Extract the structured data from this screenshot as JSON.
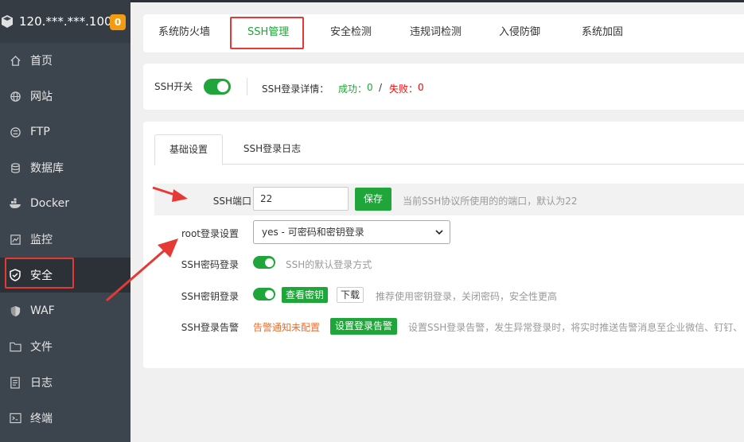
{
  "server": {
    "ip": "120.***.***.100",
    "badge_count": "0"
  },
  "sidebar": {
    "items": [
      {
        "label": "首页",
        "icon": "home-icon"
      },
      {
        "label": "网站",
        "icon": "globe-icon"
      },
      {
        "label": "FTP",
        "icon": "ftp-icon"
      },
      {
        "label": "数据库",
        "icon": "database-icon"
      },
      {
        "label": "Docker",
        "icon": "docker-icon"
      },
      {
        "label": "监控",
        "icon": "monitor-icon"
      },
      {
        "label": "安全",
        "icon": "shield-icon"
      },
      {
        "label": "WAF",
        "icon": "waf-shield-icon"
      },
      {
        "label": "文件",
        "icon": "folder-icon"
      },
      {
        "label": "日志",
        "icon": "log-icon"
      },
      {
        "label": "终端",
        "icon": "terminal-icon"
      }
    ],
    "active_index": 6
  },
  "tabs": [
    {
      "label": "系统防火墙"
    },
    {
      "label": "SSH管理"
    },
    {
      "label": "安全检测"
    },
    {
      "label": "违规词检测"
    },
    {
      "label": "入侵防御"
    },
    {
      "label": "系统加固"
    }
  ],
  "ssh_status": {
    "switch_label": "SSH开关",
    "detail_label": "SSH登录详情：",
    "success_label": "成功：",
    "success_count": "0",
    "separator": "/",
    "fail_label": "失败：",
    "fail_count": "0"
  },
  "subtabs": [
    {
      "label": "基础设置"
    },
    {
      "label": "SSH登录日志"
    }
  ],
  "form": {
    "port_label": "SSH端口",
    "port_value": "22",
    "save_label": "保存",
    "port_hint": "当前SSH协议所使用的的端口，默认为22",
    "root_label": "root登录设置",
    "root_value": "yes - 可密码和密钥登录",
    "password_label": "SSH密码登录",
    "password_hint": "SSH的默认登录方式",
    "key_label": "SSH密钥登录",
    "view_key_label": "查看密钥",
    "download_label": "下载",
    "key_hint": "推荐使用密钥登录，关闭密码，安全性更高",
    "alert_label": "SSH登录告警",
    "alert_status": "告警通知未配置",
    "alert_button": "设置登录告警",
    "alert_hint": "设置SSH登录告警，发生异常登录时，将实时推送告警消息至企业微信、钉钉、自"
  },
  "colors": {
    "accent": "#20a53a",
    "sidebar_bg": "#3c444d",
    "highlight_red": "#e53935",
    "warn_orange": "#f06c28"
  }
}
